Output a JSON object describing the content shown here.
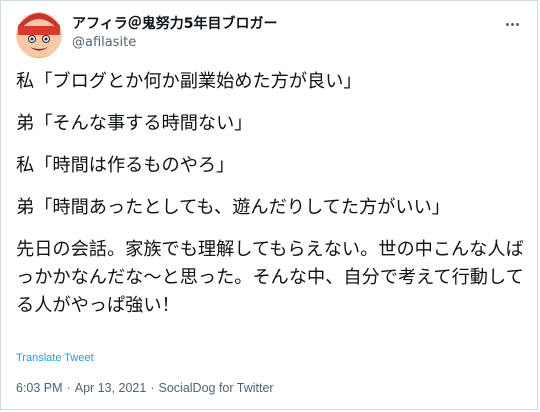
{
  "author": {
    "display_name": "アフィラ＠鬼努力5年目ブロガー",
    "handle": "@afilasite",
    "avatar_icon": "avatar-icon"
  },
  "more_icon": "more-icon",
  "tweet": {
    "paragraphs": [
      "私「ブログとか何か副業始めた方が良い」",
      "弟「そんな事する時間ない」",
      "私「時間は作るものやろ」",
      "弟「時間あったとしても、遊んだりしてた方がいい」",
      "先日の会話。家族でも理解してもらえない。世の中こんな人ばっかかなんだな～と思った。そんな中、自分で考えて行動してる人がやっぱ強い！"
    ]
  },
  "translate_label": "Translate Tweet",
  "meta": {
    "time": "6:03 PM",
    "separator": "·",
    "date": "Apr 13, 2021",
    "source": "SocialDog for Twitter"
  },
  "colors": {
    "link": "#1d9bf0",
    "secondary_text": "#536471",
    "border": "#cfd9de"
  }
}
